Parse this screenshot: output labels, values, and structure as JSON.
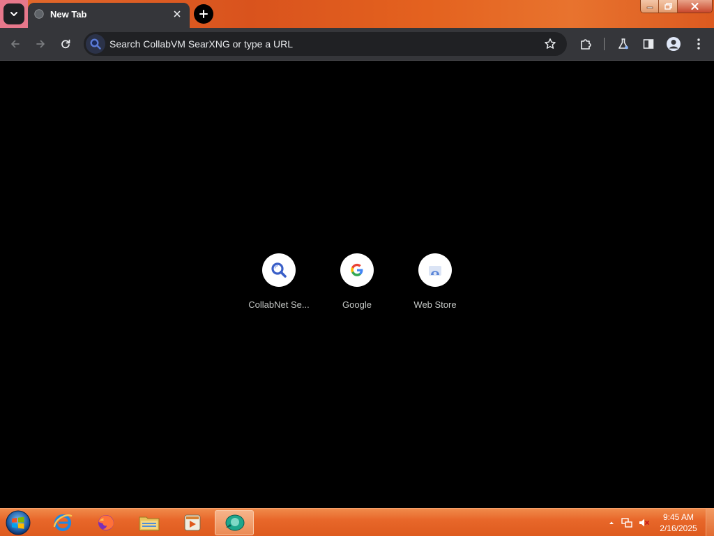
{
  "browser": {
    "tab": {
      "title": "New Tab",
      "close_icon": "close-icon"
    },
    "omnibox": {
      "placeholder": "Search CollabVM SearXNG or type a URL"
    },
    "toolbar_icons": [
      "back-icon",
      "forward-icon",
      "reload-icon",
      "bookmark-star-icon",
      "extensions-icon",
      "labs-flask-icon",
      "side-panel-icon",
      "profile-icon",
      "menu-icon"
    ]
  },
  "shortcuts": [
    {
      "label": "CollabNet Se...",
      "icon": "search-icon"
    },
    {
      "label": "Google",
      "icon": "google-icon"
    },
    {
      "label": "Web Store",
      "icon": "web-store-icon"
    }
  ],
  "taskbar": {
    "items": [
      "internet-explorer-icon",
      "firefox-icon",
      "file-explorer-icon",
      "media-player-icon",
      "chrome-icon"
    ],
    "clock": {
      "time": "9:45 AM",
      "date": "2/16/2025"
    }
  },
  "colors": {
    "tab_bg": "#35363a",
    "content_bg": "#000000",
    "taskbar": "#e8672a",
    "omnibox_bg": "#202124"
  }
}
